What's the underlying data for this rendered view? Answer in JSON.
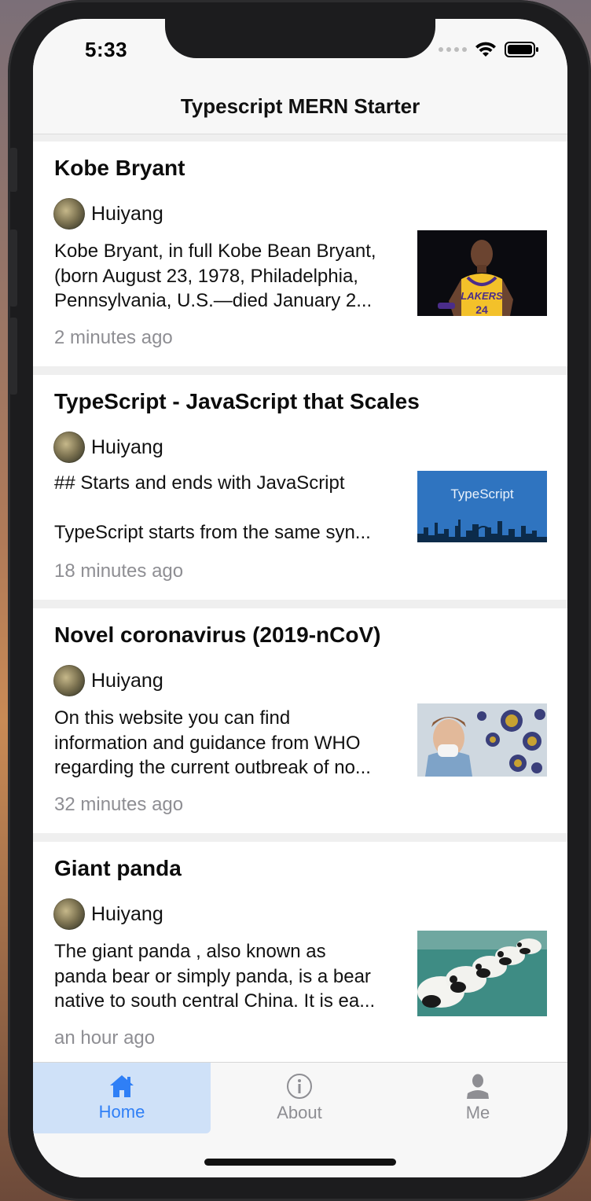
{
  "status_bar": {
    "time": "5:33"
  },
  "header": {
    "title": "Typescript MERN Starter"
  },
  "articles": [
    {
      "title": "Kobe Bryant",
      "author": "Huiyang",
      "excerpt_lines": [
        "Kobe Bryant, in full Kobe Bean Bryant,",
        "(born August 23, 1978, Philadelphia,",
        "Pennsylvania, U.S.—died January 2..."
      ],
      "time_ago": "2 minutes ago",
      "thumb_icon": "basketball-player-image"
    },
    {
      "title": "TypeScript - JavaScript that Scales",
      "author": "Huiyang",
      "excerpt_lines": [
        "## Starts and ends with JavaScript",
        "",
        "TypeScript starts from the same syn..."
      ],
      "time_ago": "18 minutes ago",
      "thumb_icon": "typescript-banner-image",
      "thumb_text": "TypeScript"
    },
    {
      "title": "Novel coronavirus (2019-nCoV)",
      "author": "Huiyang",
      "excerpt_lines": [
        "On this website you can find",
        "information and guidance from WHO",
        "regarding the current outbreak of no..."
      ],
      "time_ago": "32 minutes ago",
      "thumb_icon": "virus-image"
    },
    {
      "title": "Giant panda",
      "author": "Huiyang",
      "excerpt_lines": [
        "The giant panda , also known as",
        "panda bear or simply panda, is a bear",
        "native to south central China. It is ea..."
      ],
      "time_ago": "an hour ago",
      "thumb_icon": "panda-cubs-image"
    }
  ],
  "tabs": [
    {
      "label": "Home",
      "icon": "home-icon",
      "active": true
    },
    {
      "label": "About",
      "icon": "info-icon",
      "active": false
    },
    {
      "label": "Me",
      "icon": "person-icon",
      "active": false
    }
  ],
  "colors": {
    "accent": "#2f7ff6",
    "active_tab_bg": "#cfe1f8",
    "muted_text": "#8e8e93",
    "separator_bg": "#efefef"
  }
}
